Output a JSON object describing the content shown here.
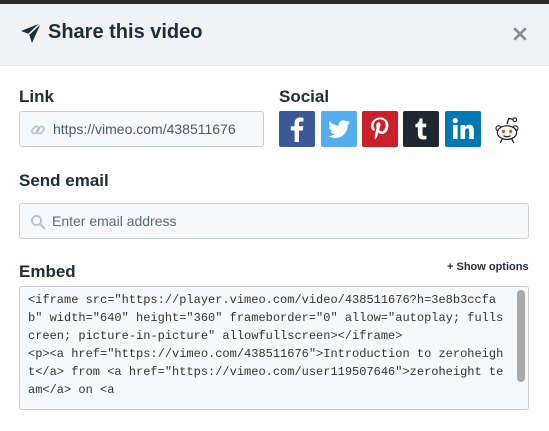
{
  "header": {
    "title": "Share this video",
    "icon": "paper-plane-icon"
  },
  "link": {
    "label": "Link",
    "url": "https://vimeo.com/438511676"
  },
  "social": {
    "label": "Social",
    "networks": [
      {
        "name": "facebook",
        "color": "#3b5998"
      },
      {
        "name": "twitter",
        "color": "#55acee"
      },
      {
        "name": "pinterest",
        "color": "#cb2027"
      },
      {
        "name": "tumblr",
        "color": "#32465a"
      },
      {
        "name": "linkedin",
        "color": "#0077b5"
      },
      {
        "name": "reddit",
        "color": "#ff4500"
      }
    ]
  },
  "email": {
    "label": "Send email",
    "placeholder": "Enter email address"
  },
  "embed": {
    "label": "Embed",
    "show_options": "+ Show options",
    "code": "<iframe src=\"https://player.vimeo.com/video/438511676?h=3e8b3ccfab\" width=\"640\" height=\"360\" frameborder=\"0\" allow=\"autoplay; fullscreen; picture-in-picture\" allowfullscreen></iframe>\n<p><a href=\"https://vimeo.com/438511676\">Introduction to zeroheight</a> from <a href=\"https://vimeo.com/user119507646\">zeroheight team</a> on <a"
  }
}
